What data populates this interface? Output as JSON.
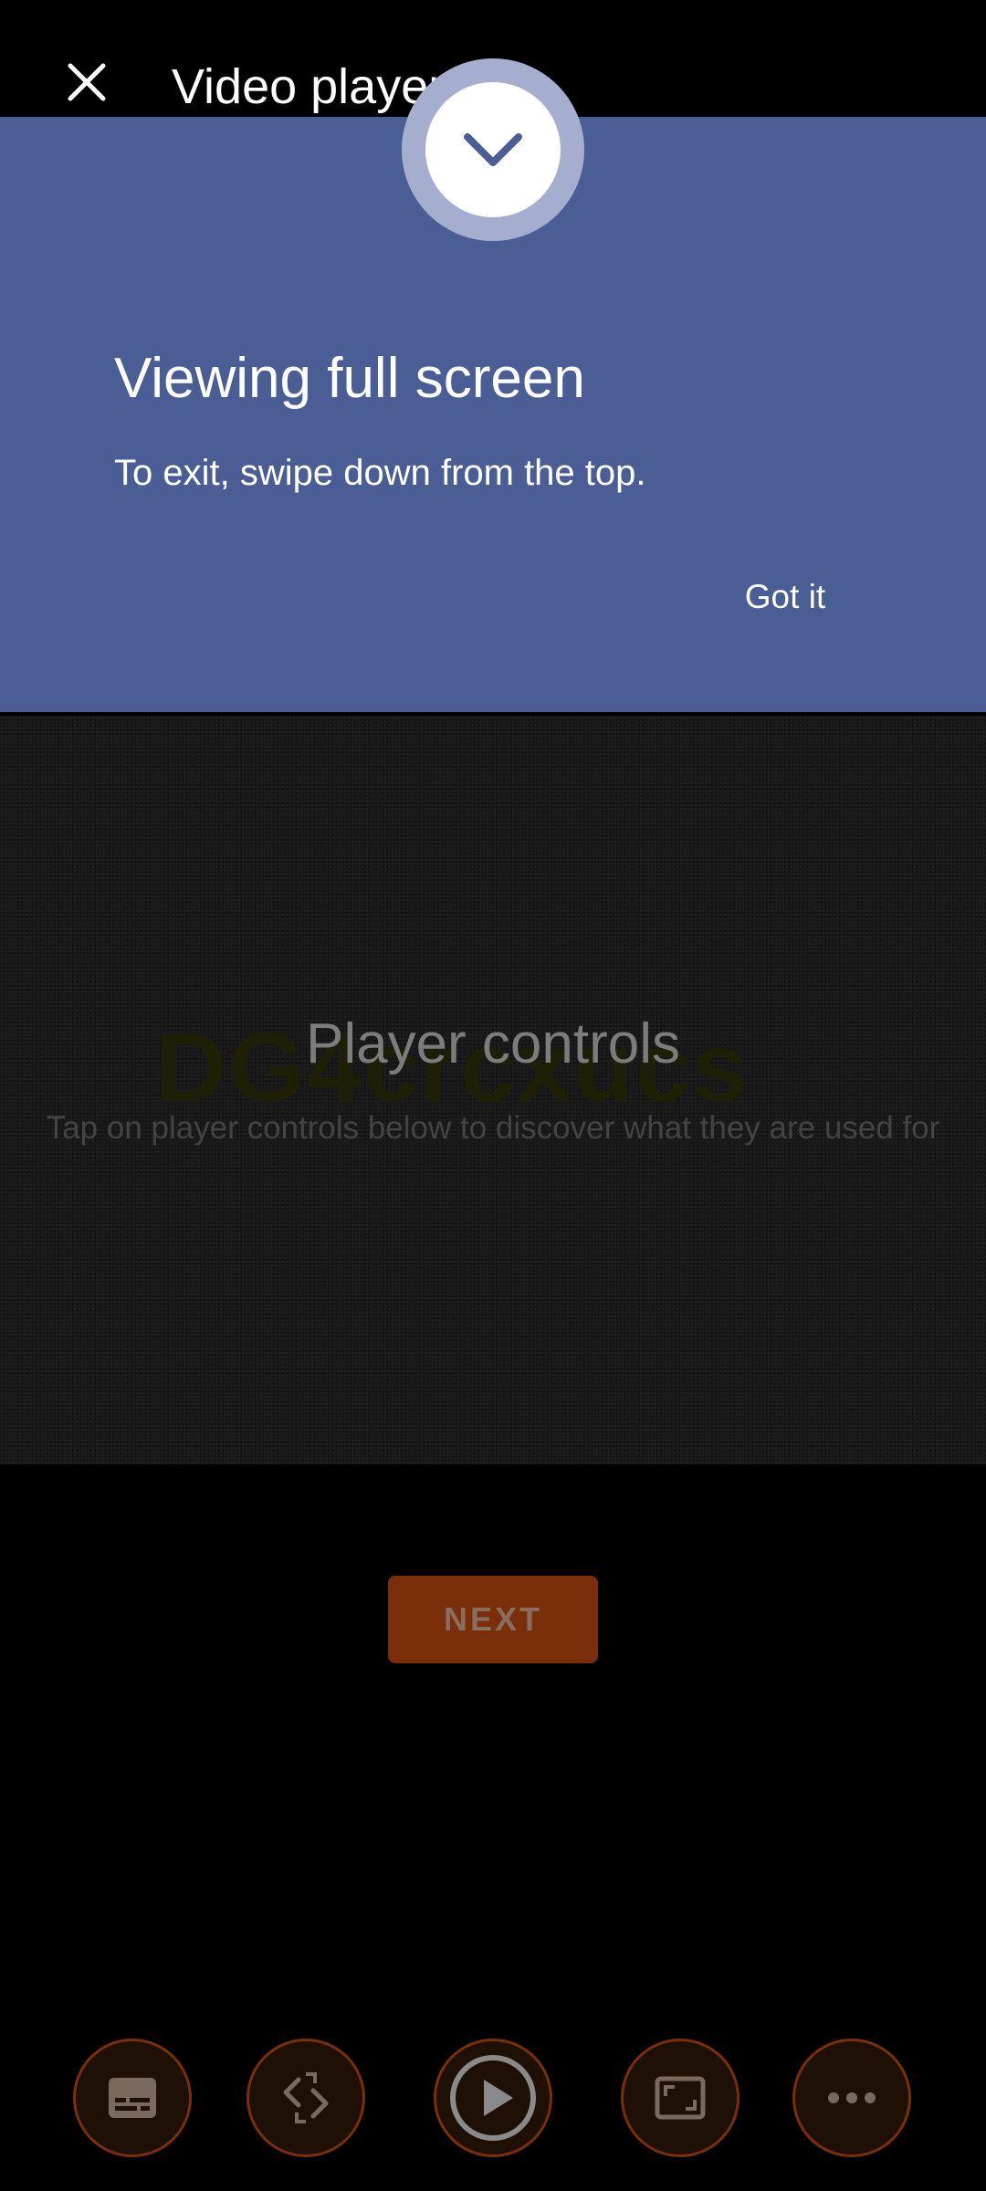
{
  "app_bar": {
    "title": "Video player tips",
    "close_icon": "close-icon"
  },
  "tooltip": {
    "handle_icon": "chevron-down-icon",
    "heading": "Viewing full screen",
    "body": "To exit, swipe down from the top.",
    "action_label": "Got it",
    "background_color": "#4a5d95"
  },
  "video": {
    "watermark": "DG4crcxucs",
    "title": "Player controls",
    "description": "Tap on player controls below to discover what they are used for"
  },
  "next_button": {
    "label": "NEXT",
    "color": "#7b2e0a"
  },
  "controls": [
    {
      "icon": "subtitles-icon"
    },
    {
      "icon": "rotate-icon"
    },
    {
      "icon": "play-icon"
    },
    {
      "icon": "aspect-ratio-icon"
    },
    {
      "icon": "more-icon"
    }
  ]
}
